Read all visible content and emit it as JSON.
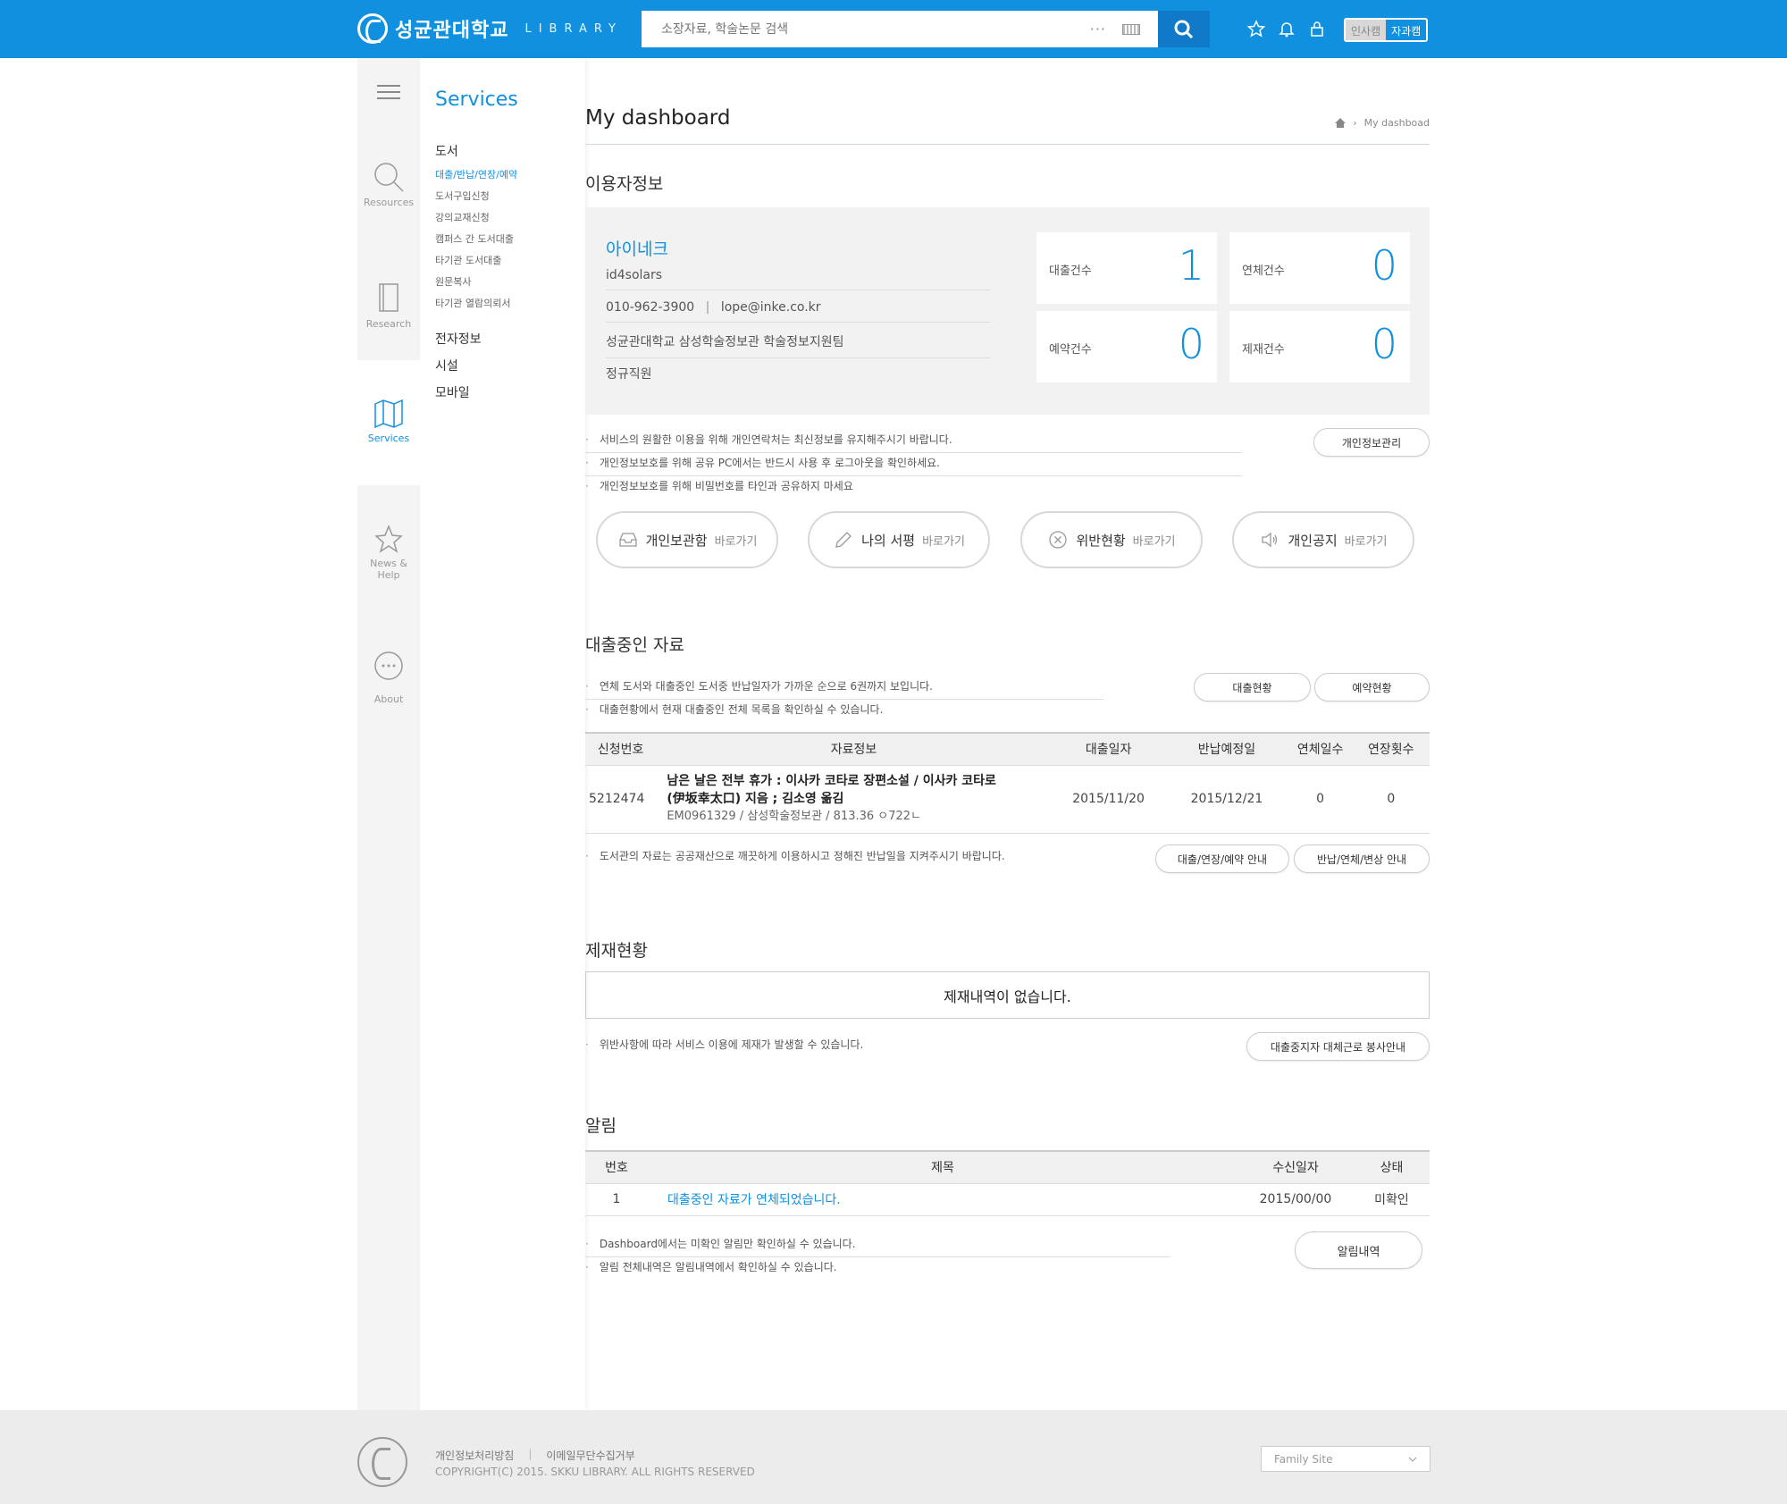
{
  "header": {
    "logo_name": "성균관대학교",
    "logo_sub": "LIBRARY",
    "search_placeholder": "소장자료, 학술논문 검색",
    "search_dots": "···",
    "campus_humanities": "인사캠",
    "campus_science": "자과캠"
  },
  "rail": {
    "resources": "Resources",
    "research": "Research",
    "services": "Services",
    "news_help": "News & Help",
    "about": "About"
  },
  "subnav": {
    "title": "Services",
    "group_books": "도서",
    "items": [
      "대출/반납/연장/예약",
      "도서구입신청",
      "강의교재신청",
      "캠퍼스 간 도서대출",
      "타기관 도서대출",
      "원문복사",
      "타기관 열람의뢰서"
    ],
    "group_e": "전자정보",
    "group_facility": "시설",
    "group_mobile": "모바일"
  },
  "page": {
    "title": "My dashboard",
    "breadcrumb": "My dashboad"
  },
  "user": {
    "section_title": "이용자정보",
    "name": "아이네크",
    "id": "id4solars",
    "phone": "010-962-3900",
    "email": "lope@inke.co.kr",
    "dept": "성균관대학교 삼성학술정보관 학술정보지원팀",
    "role": "정규직원",
    "stats": [
      {
        "label": "대출건수",
        "value": "1"
      },
      {
        "label": "연체건수",
        "value": "0"
      },
      {
        "label": "예약건수",
        "value": "0"
      },
      {
        "label": "제재건수",
        "value": "0"
      }
    ],
    "notes": [
      "서비스의 원활한 이용을 위해 개인연락처는 최신정보를 유지해주시기 바랍니다.",
      "개인정보보호를 위해 공유 PC에서는 반드시 사용 후 로그아웃을 확인하세요.",
      "개인정보보호를 위해 비밀번호를 타인과 공유하지 마세요"
    ],
    "manage_button": "개인정보관리"
  },
  "quick": [
    {
      "label": "개인보관함",
      "sub": "바로가기"
    },
    {
      "label": "나의 서평",
      "sub": "바로가기"
    },
    {
      "label": "위반현황",
      "sub": "바로가기"
    },
    {
      "label": "개인공지",
      "sub": "바로가기"
    }
  ],
  "loans": {
    "section_title": "대출중인 자료",
    "notes": [
      "연체 도서와 대출중인 도서중 반납일자가 가까운 순으로 6권까지 보입니다.",
      "대출현황에서 현재 대출중인 전체 목록을 확인하실 수 있습니다."
    ],
    "btn_status": "대출현황",
    "btn_reserve": "예약현황",
    "columns": [
      "신청번호",
      "자료정보",
      "대출일자",
      "반납예정일",
      "연체일수",
      "연장횟수"
    ],
    "rows": [
      {
        "no": "5212474",
        "title1": "남은 날은 전부 휴가 : 이사카 코타로 장편소설 / 이사카 코타로",
        "title2": "(伊坂幸太口) 지음 ; 김소영 옮김",
        "callno": "EM0961329 / 삼성학술정보관 / 813.36 ㅇ722ㄴ",
        "loan_date": "2015/11/20",
        "due_date": "2015/12/21",
        "overdue": "0",
        "renewals": "0"
      }
    ],
    "footer_note": "도서관의 자료는 공공재산으로 깨끗하게 이용하시고 정해진 반납일을 지켜주시기 바랍니다.",
    "btn_guide1": "대출/연장/예약 안내",
    "btn_guide2": "반납/연체/변상 안내"
  },
  "sanction": {
    "section_title": "제재현황",
    "empty": "제재내역이 없습니다.",
    "note": "위반사항에 따라 서비스 이용에 제재가 발생할 수 있습니다.",
    "btn": "대출중지자 대체근로 봉사안내"
  },
  "alerts": {
    "section_title": "알림",
    "columns": [
      "번호",
      "제목",
      "수신일자",
      "상태"
    ],
    "rows": [
      {
        "no": "1",
        "title": "대출중인 자료가 연체되었습니다.",
        "date": "2015/00/00",
        "status": "미확인"
      }
    ],
    "notes": [
      "Dashboard에서는 미확인 알림만 확인하실 수 있습니다.",
      "알림 전체내역은 알림내역에서 확인하실 수 있습니다."
    ],
    "btn": "알림내역"
  },
  "footer": {
    "privacy": "개인정보처리방침",
    "sep": "|",
    "email_policy": "이메일무단수집거부",
    "copyright": "COPYRIGHT(C) 2015. SKKU LIBRARY. ALL RIGHTS RESERVED",
    "family_site": "Family Site"
  },
  "colors": {
    "brand": "#1190df",
    "brand_dark": "#1079c8"
  }
}
